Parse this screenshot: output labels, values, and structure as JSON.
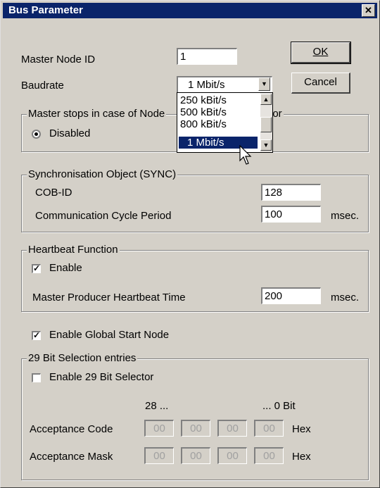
{
  "window": {
    "title": "Bus Parameter",
    "close": "✕"
  },
  "master_node": {
    "label": "Master Node ID",
    "value": "1"
  },
  "baudrate": {
    "label": "Baudrate",
    "value": "1 Mbit/s",
    "options": [
      "250 kBit/s",
      "500 kBit/s",
      "800 kBit/s",
      "1 Mbit/s"
    ]
  },
  "buttons": {
    "ok": "OK",
    "cancel": "Cancel"
  },
  "master_stops": {
    "title_left": "Master stops in case of Node",
    "title_right": "t Error",
    "radio_label": "Disabled"
  },
  "sync": {
    "title": "Synchronisation Object (SYNC)",
    "cob_label": "COB-ID",
    "cob_value": "128",
    "cycle_label": "Communication Cycle Period",
    "cycle_value": "100",
    "cycle_unit": "msec."
  },
  "heartbeat": {
    "title": "Heartbeat Function",
    "enable_label": "Enable",
    "time_label": "Master Producer Heartbeat Time",
    "time_value": "200",
    "time_unit": "msec."
  },
  "global_start": {
    "label": "Enable Global Start Node"
  },
  "bit29": {
    "title": "29 Bit Selection entries",
    "enable_label": "Enable 29 Bit Selector",
    "high_bit": "28 ...",
    "low_bit": "... 0  Bit",
    "code_label": "Acceptance Code",
    "mask_label": "Acceptance Mask",
    "code_values": [
      "00",
      "00",
      "00",
      "00"
    ],
    "mask_values": [
      "00",
      "00",
      "00",
      "00"
    ],
    "unit": "Hex"
  },
  "colors": {
    "titlebar": "#0a246a",
    "face": "#d4d0c8",
    "selection": "#0a246a"
  }
}
